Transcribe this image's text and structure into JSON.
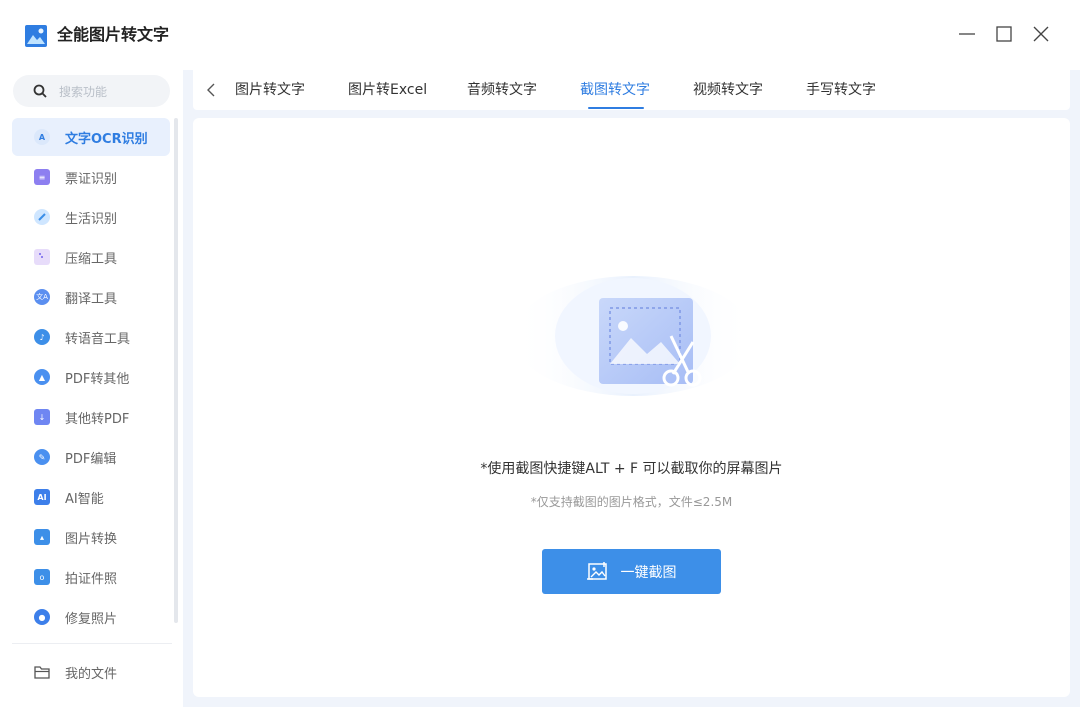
{
  "app": {
    "title": "全能图片转文字",
    "logo_icon": "picture-logo-icon"
  },
  "window_controls": [
    "minimize-icon",
    "maximize-icon",
    "close-icon"
  ],
  "sidebar": {
    "search_placeholder": "搜索功能",
    "items": [
      {
        "label": "文字OCR识别",
        "icon": "ocr-icon",
        "active": true
      },
      {
        "label": "票证识别",
        "icon": "ticket-icon"
      },
      {
        "label": "生活识别",
        "icon": "leaf-icon"
      },
      {
        "label": "压缩工具",
        "icon": "compress-icon"
      },
      {
        "label": "翻译工具",
        "icon": "translate-icon"
      },
      {
        "label": "转语音工具",
        "icon": "voice-icon"
      },
      {
        "label": "PDF转其他",
        "icon": "pdf-icon"
      },
      {
        "label": "其他转PDF",
        "icon": "to-pdf-icon"
      },
      {
        "label": "PDF编辑",
        "icon": "pdf-edit-icon"
      },
      {
        "label": "AI智能",
        "icon": "ai-icon"
      },
      {
        "label": "图片转换",
        "icon": "image-convert-icon"
      },
      {
        "label": "拍证件照",
        "icon": "camera-icon"
      },
      {
        "label": "修复照片",
        "icon": "photo-repair-icon"
      }
    ],
    "my_files": "我的文件"
  },
  "tabs": [
    {
      "label": "图片转文字"
    },
    {
      "label": "图片转Excel"
    },
    {
      "label": "音频转文字"
    },
    {
      "label": "截图转文字",
      "active": true
    },
    {
      "label": "视频转文字"
    },
    {
      "label": "手写转文字"
    }
  ],
  "panel": {
    "hint_main": "*使用截图快捷键ALT + F 可以截取你的屏幕图片",
    "hint_sub": "*仅支持截图的图片格式，文件≤2.5M",
    "button_label": "一键截图",
    "illustration_icon": "screenshot-scissors-icon"
  },
  "colors": {
    "accent": "#2f7de1",
    "button": "#3d8fe8",
    "main_bg": "#f0f4fb"
  }
}
